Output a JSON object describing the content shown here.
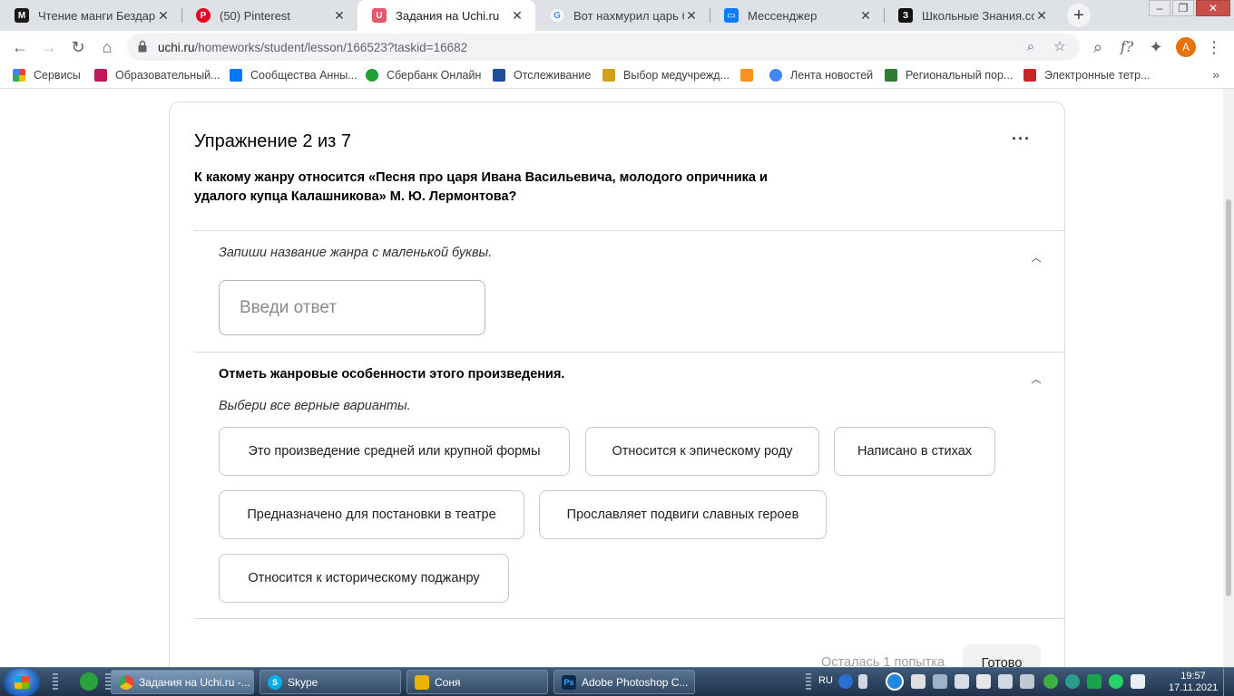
{
  "browser": {
    "tabs": [
      {
        "title": "Чтение манги Бездарна",
        "icon": "manga-icon",
        "color": "#1a1a1a",
        "glyph": "M"
      },
      {
        "title": "(50) Pinterest",
        "icon": "pinterest-icon",
        "color": "#e60023",
        "glyph": "P"
      },
      {
        "title": "Задания на Uchi.ru",
        "icon": "uchi-icon",
        "color": "#e05a6b",
        "glyph": "U"
      },
      {
        "title": "Вот нахмурил царь бро",
        "icon": "google-icon",
        "color": "#4285f4",
        "glyph": "G"
      },
      {
        "title": "Мессенджер",
        "icon": "messenger-icon",
        "color": "#0a7cff",
        "glyph": "◼"
      },
      {
        "title": "Школьные Знания.com",
        "icon": "znanija-icon",
        "color": "#111111",
        "glyph": "З"
      }
    ],
    "active_tab_index": 2,
    "url_host": "uchi.ru",
    "url_path": "/homeworks/student/lesson/166523?taskid=16682",
    "avatar_letter": "A",
    "bookmarks": [
      {
        "label": "Сервисы",
        "color": "#ea4335"
      },
      {
        "label": "Образовательный...",
        "color": "#c2185b"
      },
      {
        "label": "Сообщества Анны...",
        "color": "#0077ff"
      },
      {
        "label": "Сбербанк Онлайн",
        "color": "#21a038"
      },
      {
        "label": "Отслеживание",
        "color": "#1f4e9c"
      },
      {
        "label": "Выбор медучрежд...",
        "color": "#d4a017"
      },
      {
        "label": "",
        "color": "#f7931e"
      },
      {
        "label": "Лента новостей",
        "color": "#4285f4"
      },
      {
        "label": "Региональный пор...",
        "color": "#2e7d32"
      },
      {
        "label": "Электронные тетр...",
        "color": "#c62828"
      }
    ]
  },
  "exercise": {
    "title": "Упражнение 2 из 7",
    "question": "К какому жанру относится «Песня про царя Ивана Васильевича, молодого опричника и удалого купца Калашникова» М. Ю. Лермонтова?",
    "part1": {
      "hint": "Запиши название жанра с маленькой буквы.",
      "placeholder": "Введи ответ",
      "value": ""
    },
    "part2": {
      "title": "Отметь жанровые особенности этого произведения.",
      "hint": "Выбери все верные варианты.",
      "options": [
        "Это произведение средней или крупной формы",
        "Относится к эпическому роду",
        "Написано в стихах",
        "Предназначено для постановки в театре",
        "Прославляет подвиги славных героев",
        "Относится к историческому поджанру"
      ]
    },
    "attempts_left": "Осталась 1 попытка",
    "done_label": "Готово"
  },
  "taskbar": {
    "tasks": [
      {
        "label": "Задания на Uchi.ru -...",
        "color": "#4285f4",
        "glyph": "G"
      },
      {
        "label": "Skype",
        "color": "#00aff0",
        "glyph": "S"
      },
      {
        "label": "Соня",
        "color": "#e8b400",
        "glyph": "▮"
      },
      {
        "label": "Adobe Photoshop C...",
        "color": "#0b2a4a",
        "glyph": "Ps"
      }
    ],
    "lang": "RU",
    "time": "19:57",
    "date": "17.11.2021"
  }
}
